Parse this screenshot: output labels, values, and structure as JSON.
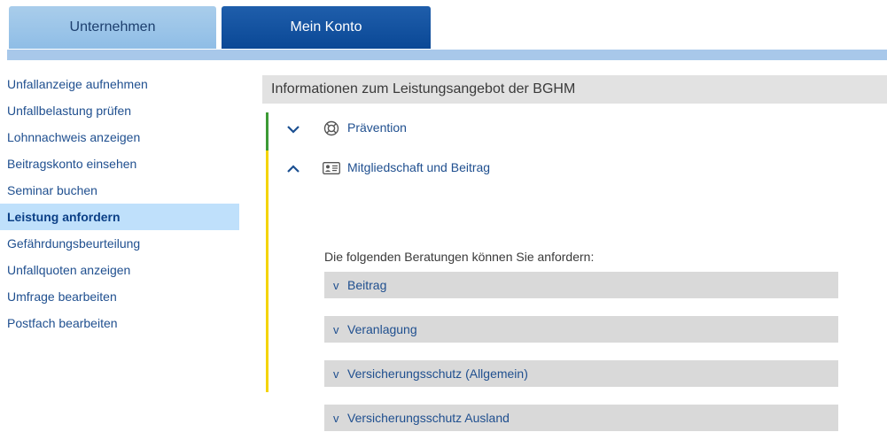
{
  "tabs": {
    "unternehmen": "Unternehmen",
    "mein_konto": "Mein Konto"
  },
  "sidebar": {
    "items": [
      {
        "label": "Unfallanzeige aufnehmen"
      },
      {
        "label": "Unfallbelastung prüfen"
      },
      {
        "label": "Lohnnachweis anzeigen"
      },
      {
        "label": "Beitragskonto einsehen"
      },
      {
        "label": "Seminar buchen"
      },
      {
        "label": "Leistung anfordern"
      },
      {
        "label": "Gefährdungsbeurteilung"
      },
      {
        "label": "Unfallquoten anzeigen"
      },
      {
        "label": "Umfrage bearbeiten"
      },
      {
        "label": "Postfach bearbeiten"
      }
    ],
    "active_index": 5
  },
  "main": {
    "title": "Informationen zum Leistungsangebot der BGHM",
    "accordion": [
      {
        "label": "Prävention",
        "icon": "lifebuoy-icon",
        "state": "collapsed"
      },
      {
        "label": "Mitgliedschaft und Beitrag",
        "icon": "id-card-icon",
        "state": "expanded"
      }
    ],
    "intro": "Die folgenden Beratungen können Sie anfordern:",
    "subitems": [
      {
        "label": "Beitrag"
      },
      {
        "label": "Veranlagung"
      },
      {
        "label": "Versicherungsschutz (Allgemein)"
      },
      {
        "label": "Versicherungsschutz Ausland"
      }
    ]
  },
  "colors": {
    "tab_active": "#0a4896",
    "tab_inactive": "#8fbde6",
    "nav_active_bg": "#bfe0fb",
    "accent_green": "#3c9a35",
    "accent_yellow": "#f4d400",
    "link_blue": "#1f4f8f"
  }
}
